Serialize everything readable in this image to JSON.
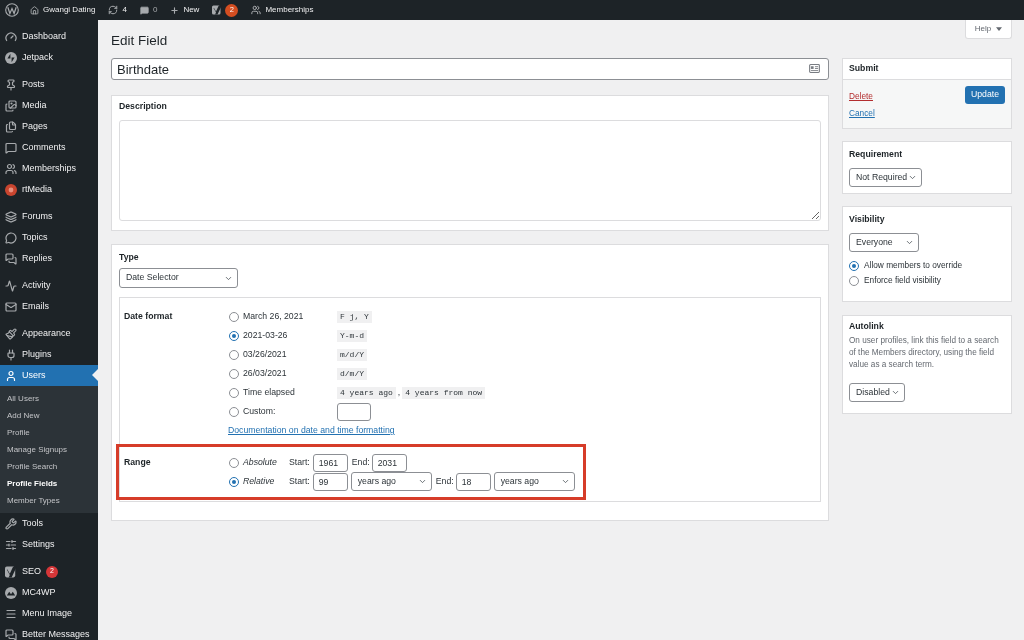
{
  "admin_bar": {
    "site_name": "Gwangi Dating",
    "updates": "4",
    "comments": "0",
    "new_label": "New",
    "seo_count": "2",
    "memberships": "Memberships"
  },
  "sidebar": {
    "groups": [
      {
        "items": [
          {
            "label": "Dashboard",
            "selected": false
          },
          {
            "label": "Jetpack",
            "selected": false
          }
        ]
      },
      {
        "items": [
          {
            "label": "Posts",
            "selected": false
          },
          {
            "label": "Media",
            "selected": false
          },
          {
            "label": "Pages",
            "selected": false
          },
          {
            "label": "Comments",
            "selected": false
          },
          {
            "label": "Memberships",
            "selected": false
          },
          {
            "label": "rtMedia",
            "selected": false
          }
        ]
      },
      {
        "items": [
          {
            "label": "Forums",
            "selected": false
          },
          {
            "label": "Topics",
            "selected": false
          },
          {
            "label": "Replies",
            "selected": false
          }
        ]
      },
      {
        "items": [
          {
            "label": "Activity",
            "selected": false
          },
          {
            "label": "Emails",
            "selected": false
          }
        ]
      },
      {
        "items": [
          {
            "label": "Appearance",
            "selected": false
          },
          {
            "label": "Plugins",
            "selected": false
          },
          {
            "label": "Users",
            "selected": true,
            "children": [
              {
                "label": "All Users",
                "selected": false
              },
              {
                "label": "Add New",
                "selected": false
              },
              {
                "label": "Profile",
                "selected": false
              },
              {
                "label": "Manage Signups",
                "selected": false
              },
              {
                "label": "Profile Search",
                "selected": false
              },
              {
                "label": "Profile Fields",
                "selected": true
              },
              {
                "label": "Member Types",
                "selected": false
              }
            ]
          },
          {
            "label": "Tools",
            "selected": false
          },
          {
            "label": "Settings",
            "selected": false
          }
        ]
      },
      {
        "items": [
          {
            "label": "SEO",
            "selected": false,
            "badge": "2"
          },
          {
            "label": "MC4WP",
            "selected": false
          },
          {
            "label": "Menu Image",
            "selected": false
          },
          {
            "label": "Better Messages",
            "selected": false
          }
        ]
      }
    ]
  },
  "help_tab": {
    "label": "Help"
  },
  "heading": "Edit Field",
  "title_field": {
    "value": "Birthdate"
  },
  "description_panel": {
    "label": "Description"
  },
  "type_panel": {
    "label": "Type",
    "select": "Date Selector",
    "date_format": {
      "label": "Date format",
      "options": [
        {
          "kind": "preset",
          "label": "March 26, 2021",
          "codes": [
            "F j, Y"
          ],
          "selected": false
        },
        {
          "kind": "preset",
          "label": "2021-03-26",
          "codes": [
            "Y-m-d"
          ],
          "selected": true
        },
        {
          "kind": "preset",
          "label": "03/26/2021",
          "codes": [
            "m/d/Y"
          ],
          "selected": false
        },
        {
          "kind": "preset",
          "label": "26/03/2021",
          "codes": [
            "d/m/Y"
          ],
          "selected": false
        },
        {
          "kind": "preset",
          "label": "Time elapsed",
          "codes": [
            "4 years ago",
            "4 years from now"
          ],
          "separator": ",",
          "selected": false
        },
        {
          "kind": "custom",
          "label": "Custom:",
          "selected": false
        }
      ],
      "link": "Documentation on date and time formatting"
    },
    "range": {
      "label": "Range",
      "highlighted": true,
      "options": [
        {
          "kind": "absolute",
          "label": "Absolute",
          "selected": false,
          "start_label": "Start:",
          "start": "1961",
          "end_label": "End:",
          "end": "2031"
        },
        {
          "kind": "relative",
          "label": "Relative",
          "selected": true,
          "start_label": "Start:",
          "start": "99",
          "start_unit": "years ago",
          "end_label": "End:",
          "end": "18",
          "end_unit": "years ago"
        }
      ]
    }
  },
  "submit_panel": {
    "title": "Submit",
    "delete": "Delete",
    "update": "Update",
    "cancel": "Cancel"
  },
  "requirement_panel": {
    "title": "Requirement",
    "select": "Not Required"
  },
  "visibility_panel": {
    "title": "Visibility",
    "select": "Everyone",
    "options": [
      {
        "label": "Allow members to override",
        "selected": true
      },
      {
        "label": "Enforce field visibility",
        "selected": false
      }
    ]
  },
  "autolink_panel": {
    "title": "Autolink",
    "description": "On user profiles, link this field to a search of the Members directory, using the field value as a search term.",
    "select": "Disabled"
  }
}
